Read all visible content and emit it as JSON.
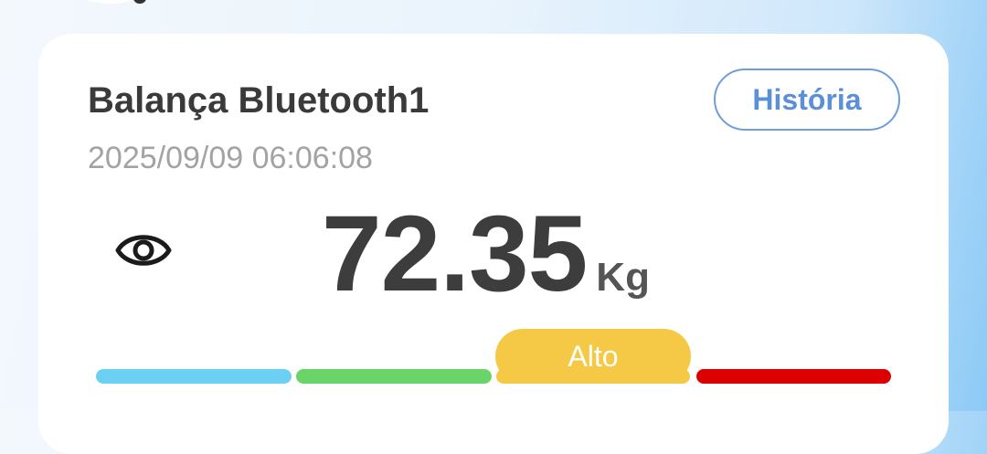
{
  "device": {
    "name": "Balança Bluetooth1",
    "timestamp": "2025/09/09 06:06:08"
  },
  "history_button": {
    "label": "História"
  },
  "measurement": {
    "value": "72.35",
    "unit": "Kg",
    "visibility_icon": "eye-icon"
  },
  "scale": {
    "status_label": "Alto",
    "active_segment": 3,
    "segments": [
      {
        "color": "#6cd0f5"
      },
      {
        "color": "#6bd468"
      },
      {
        "color": "#f5c945"
      },
      {
        "color": "#dd0000"
      }
    ]
  },
  "colors": {
    "title_text": "#3a3a3a",
    "timestamp_text": "#a3a3a3",
    "accent_blue": "#5b8fd8",
    "status_high": "#f5c945"
  }
}
